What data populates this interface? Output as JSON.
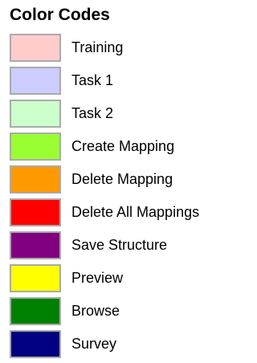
{
  "title": "Color Codes",
  "legend": [
    {
      "label": "Training",
      "color": "#ffcccc"
    },
    {
      "label": "Task 1",
      "color": "#ccccff"
    },
    {
      "label": "Task 2",
      "color": "#ccffcc"
    },
    {
      "label": "Create Mapping",
      "color": "#99ff33"
    },
    {
      "label": "Delete Mapping",
      "color": "#ff9900"
    },
    {
      "label": "Delete All Mappings",
      "color": "#ff0000"
    },
    {
      "label": "Save Structure",
      "color": "#800080"
    },
    {
      "label": "Preview",
      "color": "#ffff00"
    },
    {
      "label": "Browse",
      "color": "#008000"
    },
    {
      "label": "Survey",
      "color": "#000080"
    }
  ]
}
